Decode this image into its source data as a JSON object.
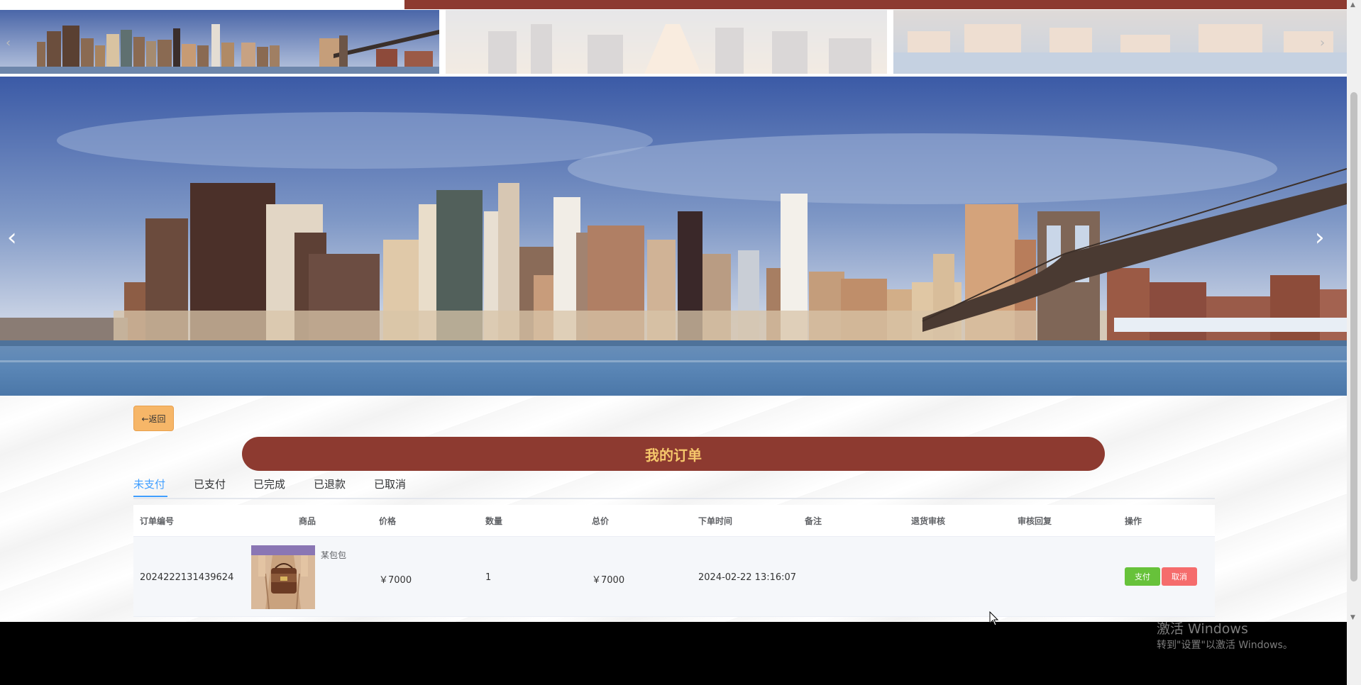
{
  "carousel": {
    "prev_arrow": "‹",
    "next_arrow": "›",
    "hero_prev": "‹",
    "hero_next": "›"
  },
  "back_button": {
    "label": "←返回"
  },
  "page_title": "我的订单",
  "tabs": [
    {
      "label": "未支付",
      "active": true
    },
    {
      "label": "已支付"
    },
    {
      "label": "已完成"
    },
    {
      "label": "已退款"
    },
    {
      "label": "已取消"
    }
  ],
  "table": {
    "headers": [
      "订单编号",
      "商品",
      "价格",
      "数量",
      "总价",
      "下单时间",
      "备注",
      "退货审核",
      "审核回复",
      "操作"
    ],
    "rows": [
      {
        "order_no": "2024222131439624",
        "product_name": "某包包",
        "price": "￥7000",
        "quantity": "1",
        "total": "￥7000",
        "order_time": "2024-02-22 13:16:07",
        "remark": "",
        "return_review": "",
        "review_reply": "",
        "pay_label": "支付",
        "cancel_label": "取消"
      }
    ]
  },
  "watermark": {
    "title": "激活 Windows",
    "subtitle": "转到\"设置\"以激活 Windows。"
  },
  "colors": {
    "brand": "#8d3a30",
    "title_text": "#f6c76b",
    "active_tab": "#409eff",
    "pay": "#67c23a",
    "cancel": "#f56c6c",
    "back": "#f6b668"
  },
  "icons": {
    "scroll_up": "▲",
    "scroll_down": "▼"
  }
}
